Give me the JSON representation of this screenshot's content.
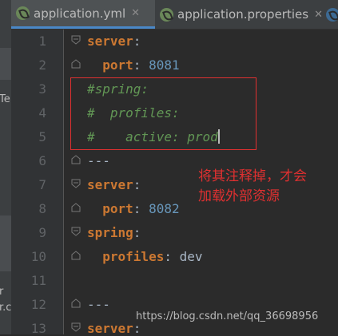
{
  "tabs": [
    {
      "label": "application.yml",
      "close": "✕",
      "active": true
    },
    {
      "label": "application.properties",
      "close": "✕",
      "active": false
    }
  ],
  "left_strip": {
    "text_1": "Te",
    "text_2": "r",
    "text_3": "r.c"
  },
  "lines": [
    {
      "num": "1",
      "key": "server",
      "value": "",
      "comment": ""
    },
    {
      "num": "2",
      "key": "port",
      "value": "8081",
      "comment": ""
    },
    {
      "num": "3",
      "comment": "#spring:"
    },
    {
      "num": "4",
      "comment": "#  profiles:"
    },
    {
      "num": "5",
      "comment": "#    active: prod"
    },
    {
      "num": "6",
      "text": "---"
    },
    {
      "num": "7",
      "key": "server"
    },
    {
      "num": "8",
      "key": "port",
      "value": "8082"
    },
    {
      "num": "9",
      "key": "spring"
    },
    {
      "num": "10",
      "key": "profiles",
      "value": "dev"
    },
    {
      "num": "11"
    },
    {
      "num": "12",
      "text": "---"
    },
    {
      "num": "13",
      "key": "server"
    }
  ],
  "annotation": {
    "line1": "将其注释掉，才会",
    "line2": "加载外部资源"
  },
  "watermark": "https://blog.csdn.net/qq_36698956"
}
